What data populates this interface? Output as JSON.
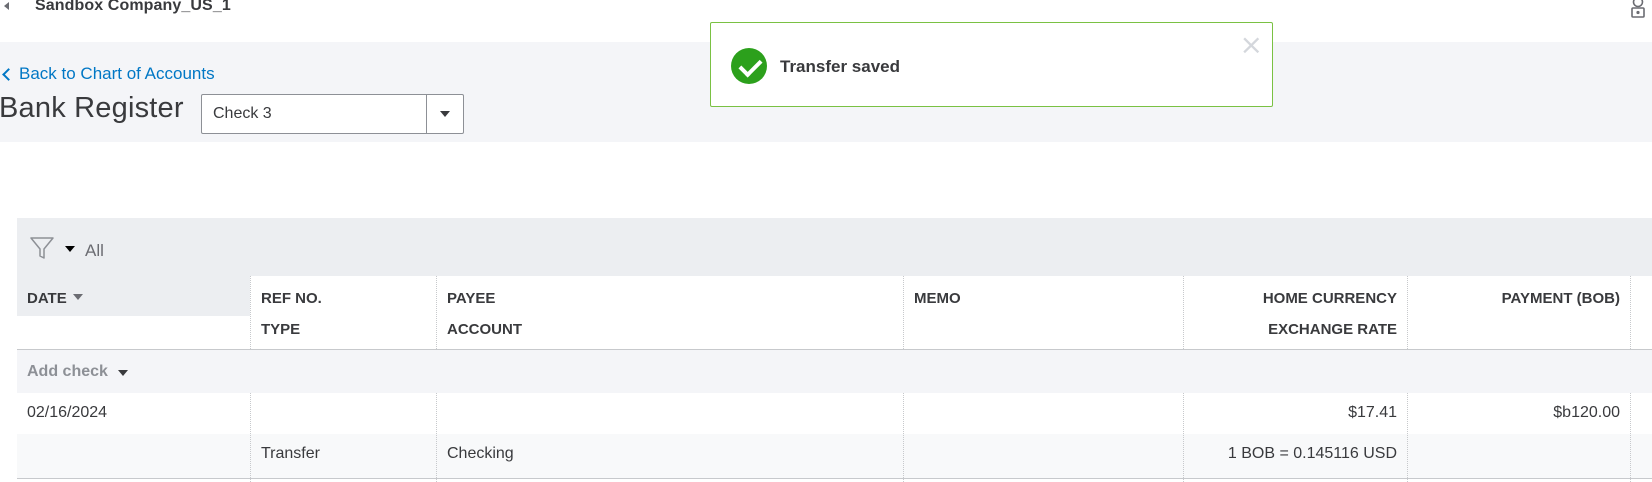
{
  "topbar": {
    "company": "Sandbox Company_US_1"
  },
  "header": {
    "back_link": "Back to Chart of Accounts",
    "title": "Bank Register",
    "account_select": "Check 3"
  },
  "toast": {
    "message": "Transfer saved"
  },
  "filter": {
    "label": "All"
  },
  "table": {
    "columns": {
      "date": "DATE",
      "ref_no": "REF NO.",
      "type": "TYPE",
      "payee": "PAYEE",
      "account": "ACCOUNT",
      "memo": "MEMO",
      "home_currency": "HOME CURRENCY",
      "exchange_rate": "EXCHANGE RATE",
      "payment": "PAYMENT (BOB)"
    },
    "add_check": "Add check",
    "rows": [
      {
        "date": "02/16/2024",
        "ref_no": "",
        "type": "Transfer",
        "payee": "",
        "account": "Checking",
        "memo": "",
        "home_currency": "$17.41",
        "exchange_rate": "1 BOB = 0.145116 USD",
        "payment": "$b120.00"
      }
    ]
  },
  "colors": {
    "link": "#0077c5",
    "success": "#2ca01c",
    "toast_border": "#7ac143",
    "header_bg": "#f4f5f8",
    "filter_bg": "#eceef1"
  },
  "icons": [
    "caret-left-icon",
    "user-icon",
    "chevron-left-icon",
    "dropdown-arrow-icon",
    "check-circle-icon",
    "close-icon",
    "filter-funnel-icon",
    "sort-desc-icon"
  ]
}
